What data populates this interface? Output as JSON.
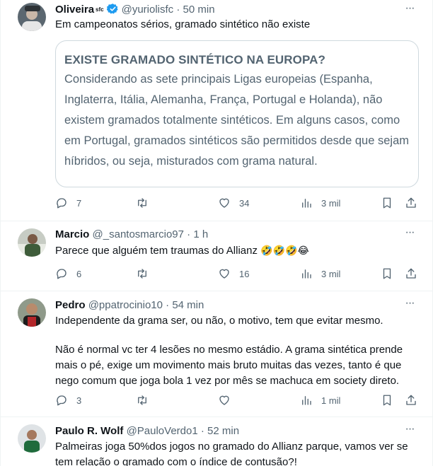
{
  "tweets": [
    {
      "name": "Oliveira",
      "badge": "sfc",
      "handle": "@yuriolisfc",
      "time": "50 min",
      "text": "Em campeonatos sérios, gramado sintético não existe",
      "quote": {
        "title": "EXISTE GRAMADO SINTÉTICO NA EUROPA?",
        "body": "Considerando as sete principais Ligas europeias (Espanha, Inglaterra, Itália, Alemanha, França, Portugal e Holanda), não existem gramados totalmente sintéticos. Em alguns casos, como em Portugal, gramados sintéticos são permitidos desde que sejam híbridos, ou seja, misturados com grama natural."
      },
      "replies": "7",
      "retweets": "",
      "likes": "34",
      "views": "3 mil"
    },
    {
      "name": "Marcio",
      "handle": "@_santosmarcio97",
      "time": "1 h",
      "text": "Parece que alguém tem traumas do Allianz",
      "emojis": "🤣🤣🤣😂",
      "replies": "6",
      "retweets": "",
      "likes": "16",
      "views": "3 mil"
    },
    {
      "name": "Pedro",
      "handle": "@ppatrocinio10",
      "time": "54 min",
      "text_p1": "Independente da grama ser, ou não, o motivo, tem que evitar mesmo.",
      "text_p2": "Não é normal vc ter 4 lesões no mesmo estádio. A grama sintética prende mais o pé, exige um movimento mais bruto muitas das vezes, tanto é que nego comum que joga bola 1 vez por mês se machuca em society direto.",
      "replies": "3",
      "retweets": "",
      "likes": "",
      "views": "1 mil"
    },
    {
      "name": "Paulo R. Wolf",
      "handle": "@PauloVerdo1",
      "time": "52 min",
      "text": "Palmeiras joga 50%dos jogos no gramado do Allianz parque, vamos ver se tem relação o gramado com o índice de contusão?!"
    }
  ],
  "separator": "·",
  "more_glyph": "···",
  "colors": {
    "text": "#0f1419",
    "muted": "#536471",
    "border": "#eff3f4",
    "verified": "#1d9bf0"
  }
}
